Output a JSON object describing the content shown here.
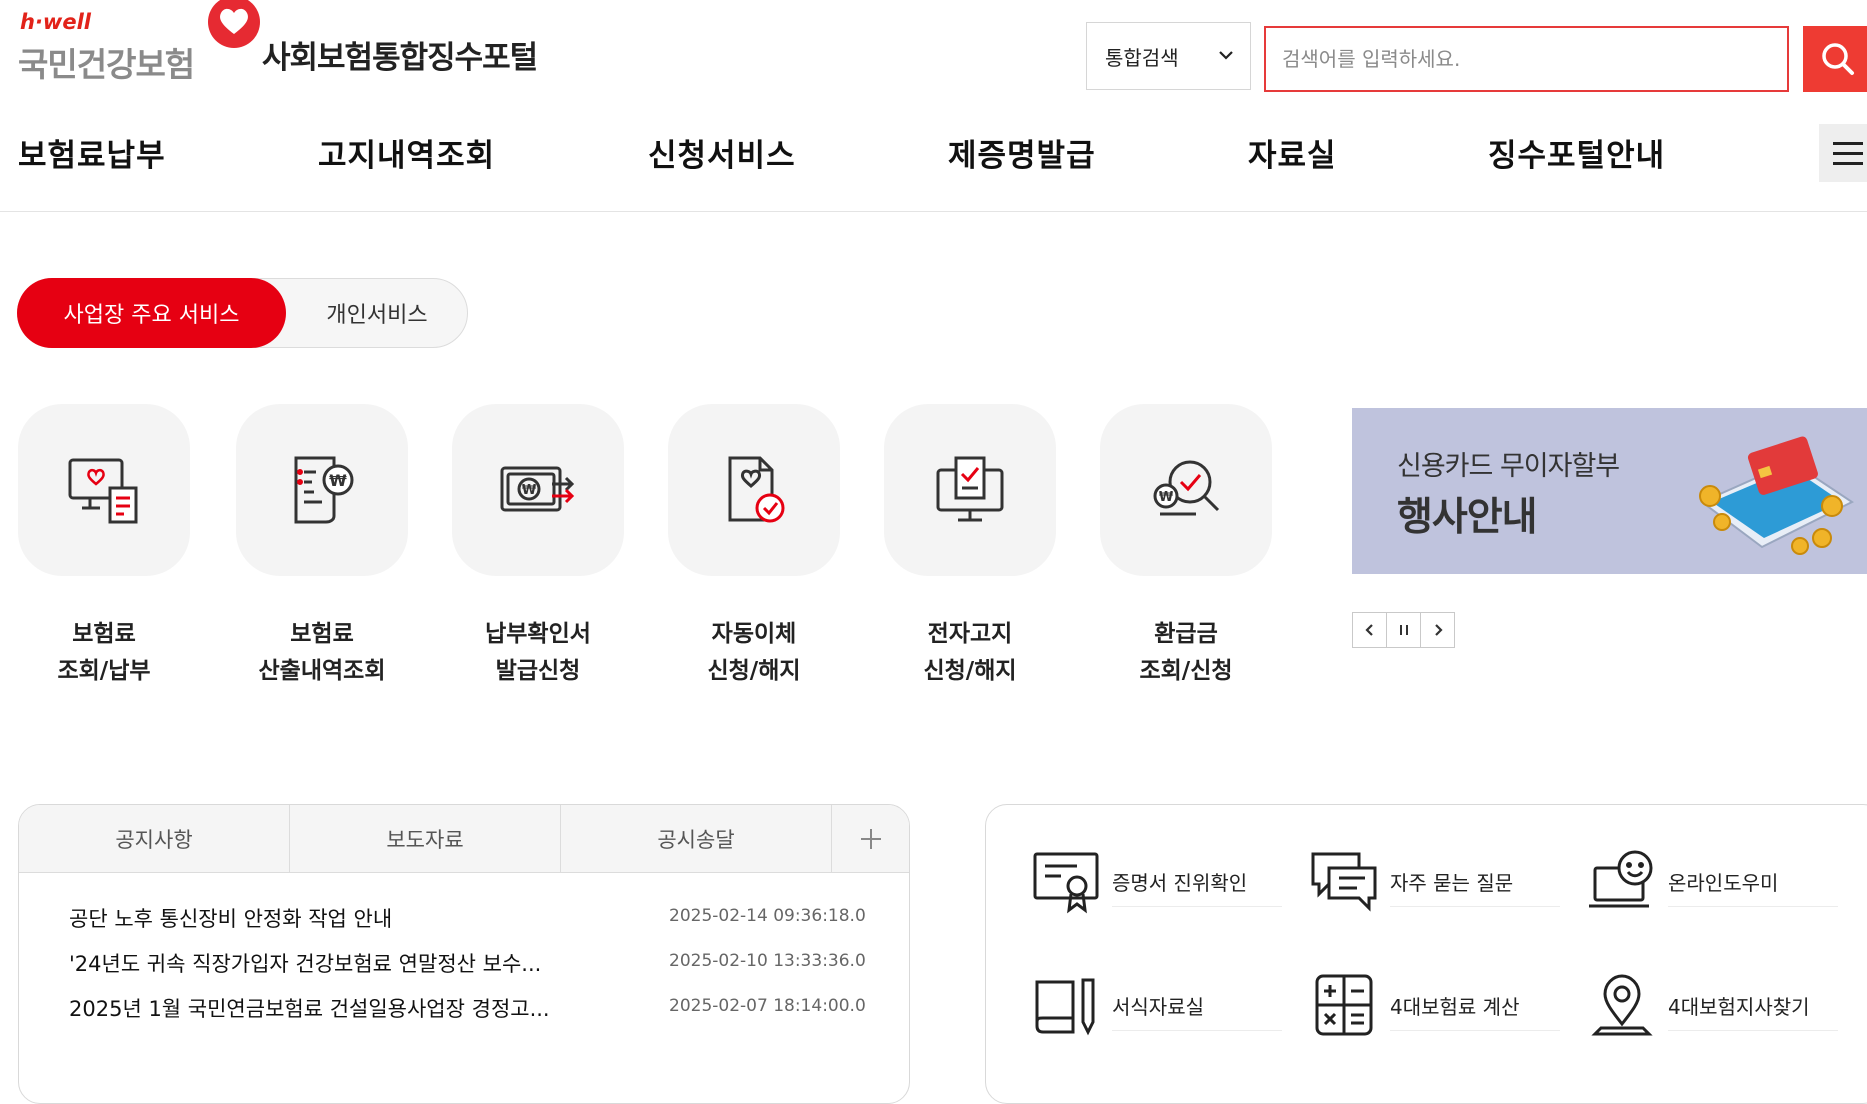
{
  "header": {
    "logo_tagline": "h·well",
    "logo_text": "국민건강보험",
    "portal_title": "사회보험통합징수포털"
  },
  "search": {
    "scope": "통합검색",
    "placeholder": "검색어를 입력하세요."
  },
  "gnb": [
    "보험료납부",
    "고지내역조회",
    "신청서비스",
    "제증명발급",
    "자료실",
    "징수포털안내"
  ],
  "service_tabs": {
    "active": "사업장 주요 서비스",
    "inactive": "개인서비스"
  },
  "services": [
    {
      "line1": "보험료",
      "line2": "조회/납부",
      "icon": "monitor-receipt-icon"
    },
    {
      "line1": "보험료",
      "line2": "산출내역조회",
      "icon": "document-calculation-icon"
    },
    {
      "line1": "납부확인서",
      "line2": "발급신청",
      "icon": "payment-transfer-icon"
    },
    {
      "line1": "자동이체",
      "line2": "신청/해지",
      "icon": "document-check-icon"
    },
    {
      "line1": "전자고지",
      "line2": "신청/해지",
      "icon": "computer-check-icon"
    },
    {
      "line1": "환급금",
      "line2": "조회/신청",
      "icon": "refund-search-icon"
    }
  ],
  "banner": {
    "subtitle": "신용카드 무이자할부",
    "title": "행사안내"
  },
  "colors": {
    "brand_red": "#e60012",
    "search_red": "#ee3b33",
    "banner_bg": "#bfc3dd"
  },
  "board": {
    "tabs": [
      "공지사항",
      "보도자료",
      "공시송달"
    ],
    "items": [
      {
        "title": "공단 노후 통신장비 안정화 작업 안내",
        "date": "2025-02-14 09:36:18.0"
      },
      {
        "title": "'24년도 귀속 직장가입자 건강보험료 연말정산 보수...",
        "date": "2025-02-10 13:33:36.0"
      },
      {
        "title": "2025년 1월 국민연금보험료 건설일용사업장 경정고...",
        "date": "2025-02-07 18:14:00.0"
      }
    ]
  },
  "quick_links": [
    {
      "label": "증명서 진위확인",
      "icon": "certificate-icon"
    },
    {
      "label": "자주 묻는 질문",
      "icon": "chat-bubble-icon"
    },
    {
      "label": "온라인도우미",
      "icon": "online-helper-icon"
    },
    {
      "label": "서식자료실",
      "icon": "book-pen-icon"
    },
    {
      "label": "4대보험료 계산",
      "icon": "calculator-icon"
    },
    {
      "label": "4대보험지사찾기",
      "icon": "location-pin-icon"
    }
  ]
}
